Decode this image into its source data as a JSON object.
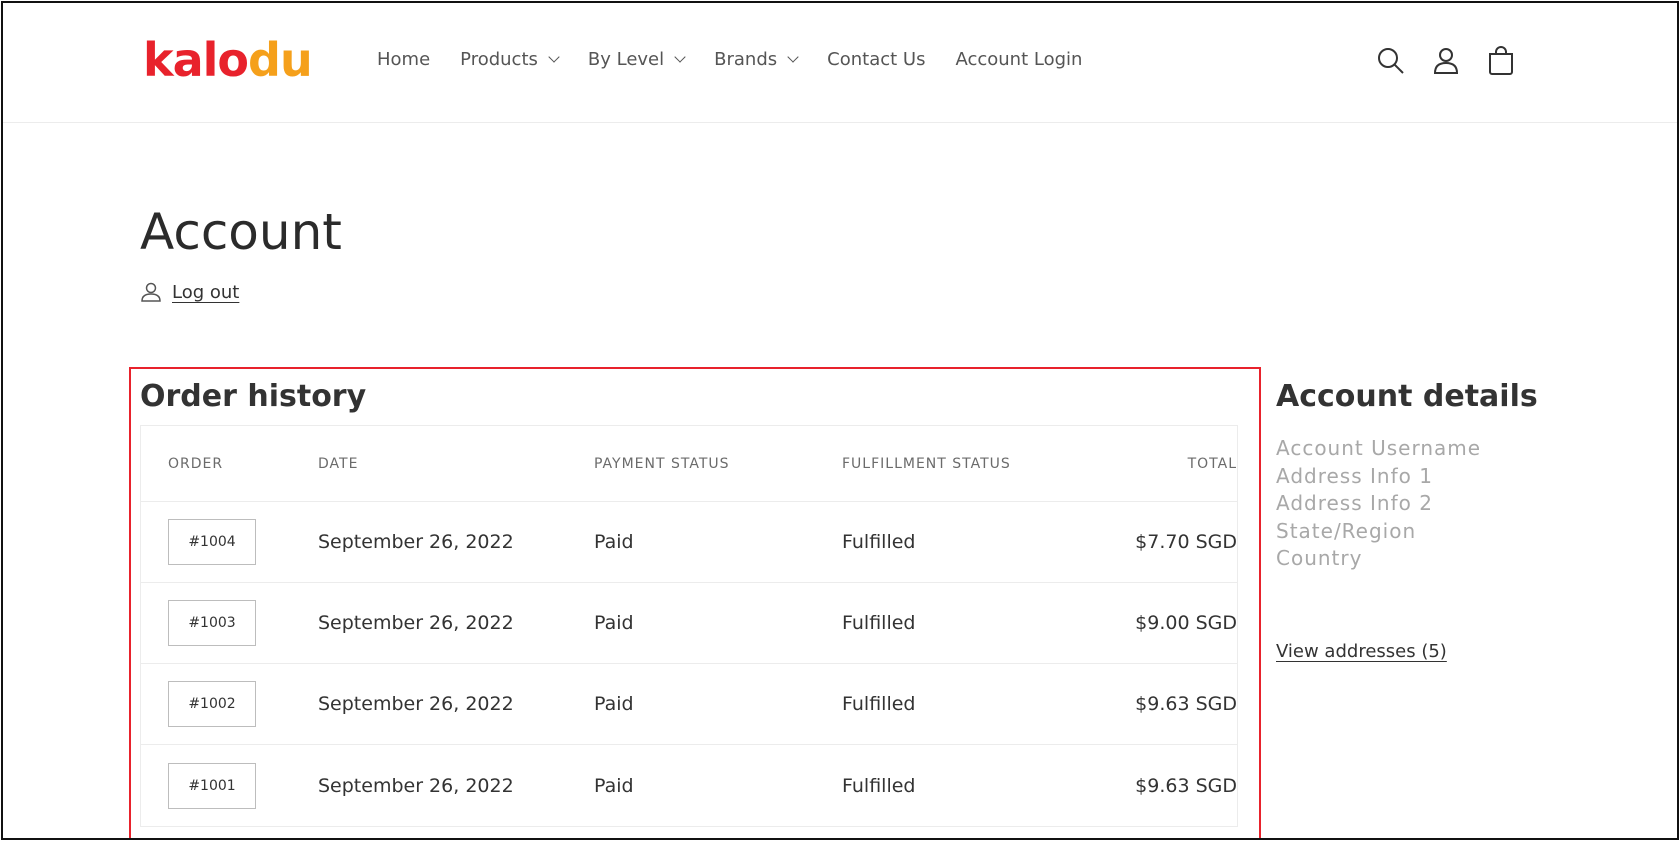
{
  "header": {
    "logo_part1": "kalo",
    "logo_part2": "du",
    "nav": [
      {
        "label": "Home",
        "dropdown": false
      },
      {
        "label": "Products",
        "dropdown": true
      },
      {
        "label": "By Level",
        "dropdown": true
      },
      {
        "label": "Brands",
        "dropdown": true
      },
      {
        "label": "Contact Us",
        "dropdown": false
      },
      {
        "label": "Account Login",
        "dropdown": false
      }
    ],
    "icons": [
      "search-icon",
      "account-icon",
      "cart-icon"
    ]
  },
  "main": {
    "title": "Account",
    "logout_label": "Log out",
    "order_history": {
      "title": "Order history",
      "columns": [
        "ORDER",
        "DATE",
        "PAYMENT STATUS",
        "FULFILLMENT STATUS",
        "TOTAL"
      ],
      "rows": [
        {
          "order": "#1004",
          "date": "September 26, 2022",
          "payment": "Paid",
          "fulfillment": "Fulfilled",
          "total": "$7.70 SGD"
        },
        {
          "order": "#1003",
          "date": "September 26, 2022",
          "payment": "Paid",
          "fulfillment": "Fulfilled",
          "total": "$9.00 SGD"
        },
        {
          "order": "#1002",
          "date": "September 26, 2022",
          "payment": "Paid",
          "fulfillment": "Fulfilled",
          "total": "$9.63 SGD"
        },
        {
          "order": "#1001",
          "date": "September 26, 2022",
          "payment": "Paid",
          "fulfillment": "Fulfilled",
          "total": "$9.63 SGD"
        }
      ]
    },
    "account_details": {
      "title": "Account details",
      "lines": [
        "Account Username",
        "Address Info 1",
        "Address Info 2",
        "State/Region",
        "Country"
      ],
      "view_addresses": "View addresses (5)"
    }
  },
  "colors": {
    "logo_red": "#e8222c",
    "logo_orange": "#f5a01b",
    "highlight_border": "#e8222c"
  }
}
